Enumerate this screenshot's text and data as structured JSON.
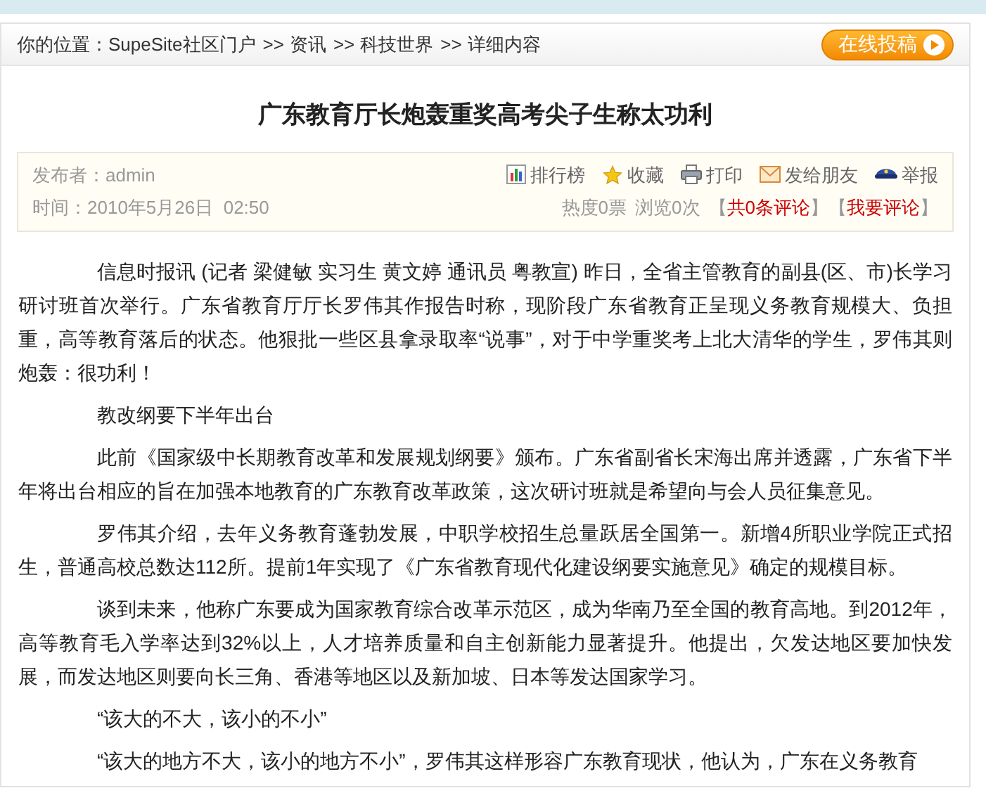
{
  "breadcrumb": {
    "label": "你的位置：",
    "items": [
      {
        "text": "SupeSite社区门户"
      },
      {
        "separator": ">>",
        "text": "资讯"
      },
      {
        "separator": ">>",
        "text": "科技世界"
      },
      {
        "separator": ">>",
        "text": "详细内容"
      }
    ]
  },
  "submit_button": {
    "label": "在线投稿"
  },
  "article": {
    "title": "广东教育厅长炮轰重奖高考尖子生称太功利",
    "meta": {
      "publisher": "发布者：admin",
      "time": "时间：2010年5月26日  02:50",
      "actions": [
        {
          "kind": "ranking",
          "label": "排行榜"
        },
        {
          "kind": "favorite",
          "label": "收藏"
        },
        {
          "kind": "print",
          "label": "打印"
        },
        {
          "kind": "send",
          "label": "发给朋友"
        },
        {
          "kind": "report",
          "label": "举报"
        }
      ],
      "heat": "热度0票",
      "views": "浏览0次",
      "comment_links": [
        {
          "open": "【",
          "text": "共0条评论",
          "close": "】"
        },
        {
          "open": "【",
          "text": "我要评论",
          "close": "】"
        }
      ]
    },
    "paragraphs": [
      "信息时报讯 (记者 梁健敏 实习生 黄文婷 通讯员 粤教宣) 昨日，全省主管教育的副县(区、市)长学习研讨班首次举行。广东省教育厅厅长罗伟其作报告时称，现阶段广东省教育正呈现义务教育规模大、负担重，高等教育落后的状态。他狠批一些区县拿录取率“说事”，对于中学重奖考上北大清华的学生，罗伟其则炮轰：很功利！",
      "教改纲要下半年出台",
      "此前《国家级中长期教育改革和发展规划纲要》颁布。广东省副省长宋海出席并透露，广东省下半年将出台相应的旨在加强本地教育的广东教育改革政策，这次研讨班就是希望向与会人员征集意见。",
      "罗伟其介绍，去年义务教育蓬勃发展，中职学校招生总量跃居全国第一。新增4所职业学院正式招生，普通高校总数达112所。提前1年实现了《广东省教育现代化建设纲要实施意见》确定的规模目标。",
      "谈到未来，他称广东要成为国家教育综合改革示范区，成为华南乃至全国的教育高地。到2012年，高等教育毛入学率达到32%以上，人才培养质量和自主创新能力显著提升。他提出，欠发达地区要加快发展，而发达地区则要向长三角、香港等地区以及新加坡、日本等发达国家学习。",
      "“该大的不大，该小的不小”",
      "“该大的地方不大，该小的地方不小”，罗伟其这样形容广东教育现状，他认为，广东在义务教育"
    ]
  }
}
